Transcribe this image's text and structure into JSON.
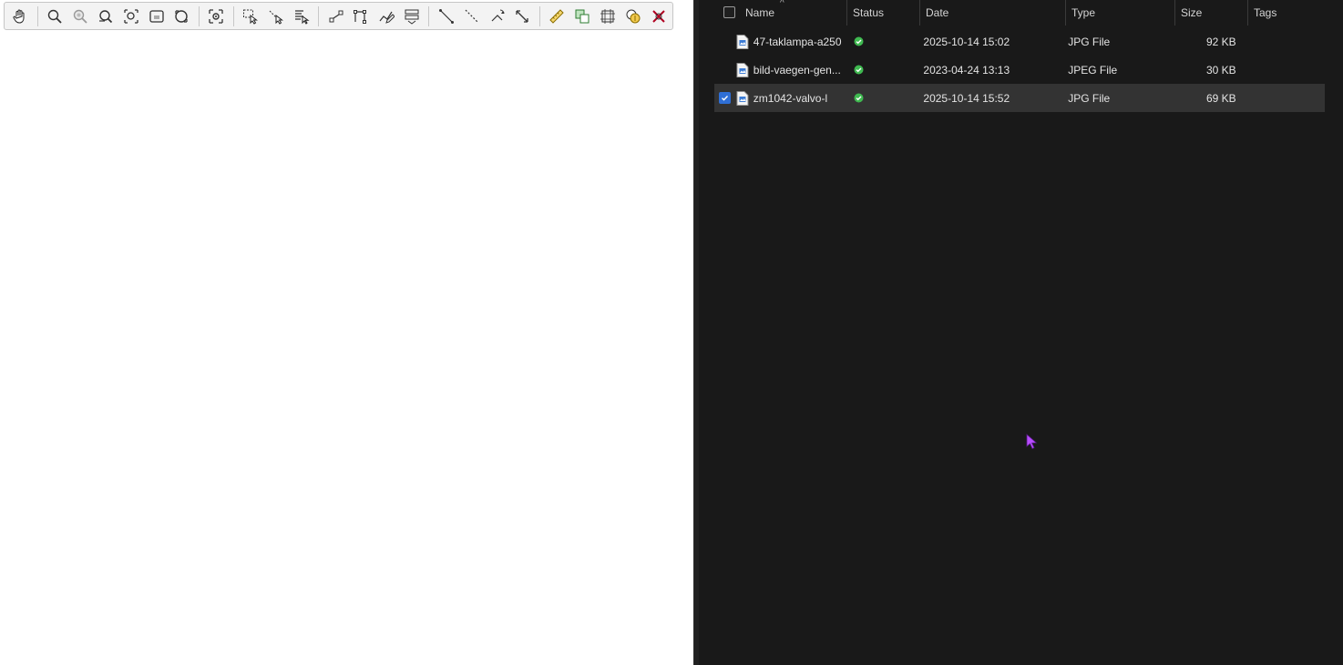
{
  "toolbar": {
    "groups": [
      [
        "pan-hand-icon"
      ],
      [
        "zoom-in-icon",
        "zoom-out-icon",
        "zoom-full-icon",
        "zoom-layer-icon",
        "zoom-selection-icon",
        "zoom-native-icon"
      ],
      [
        "zoom-to-point-icon"
      ],
      [
        "select-feature-icon",
        "deselect-icon",
        "identify-icon"
      ],
      [
        "add-node-icon",
        "vertex-tool-icon",
        "edit-shape-icon",
        "edit-attributes-icon"
      ],
      [
        "measure-line-icon",
        "split-line-icon",
        "rotate-icon",
        "scale-icon"
      ],
      [
        "ruler-icon",
        "copy-features-icon",
        "georeference-icon",
        "coin-icon",
        "remove-icon"
      ]
    ]
  },
  "explorer": {
    "columns": {
      "name": "Name",
      "status": "Status",
      "date": "Date",
      "type": "Type",
      "size": "Size",
      "tags": "Tags"
    },
    "files": [
      {
        "name": "47-taklampa-a250",
        "status": "synced",
        "date": "2025-10-14 15:02",
        "type": "JPG File",
        "size": "92 KB",
        "tags": "",
        "selected": false
      },
      {
        "name": "bild-vaegen-gen...",
        "status": "synced",
        "date": "2023-04-24 13:13",
        "type": "JPEG File",
        "size": "30 KB",
        "tags": "",
        "selected": false
      },
      {
        "name": "zm1042-valvo-l",
        "status": "synced",
        "date": "2025-10-14 15:52",
        "type": "JPG File",
        "size": "69 KB",
        "tags": "",
        "selected": true
      }
    ]
  },
  "colors": {
    "explorer_bg": "#191919",
    "row_selected": "#333333",
    "status_ok": "#3fb950",
    "checkbox_on": "#2f6fd6",
    "cursor": "#b84dff"
  }
}
